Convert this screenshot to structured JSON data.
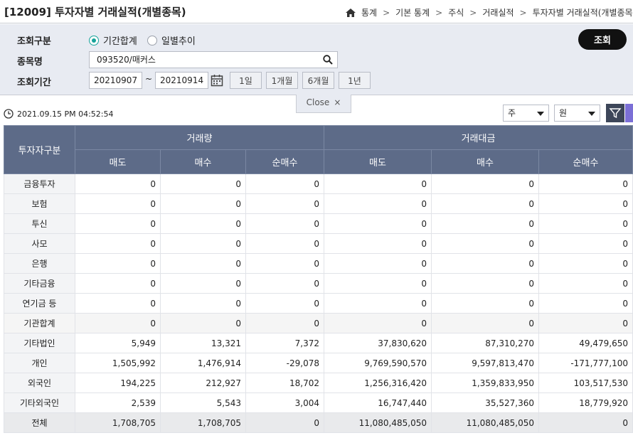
{
  "header": {
    "title": "[12009] 투자자별 거래실적(개별종목)",
    "breadcrumb": [
      "통계",
      "기본 통계",
      "주식",
      "거래실적",
      "투자자별 거래실적(개별종목"
    ]
  },
  "filter": {
    "type_label": "조회구분",
    "radio_period": "기간합계",
    "radio_daily": "일별추이",
    "selected": "기간합계",
    "stock_label": "종목명",
    "stock_value": "093520/매커스",
    "date_label": "조회기간",
    "start_date": "20210907",
    "tilde": "~",
    "end_date": "20210914",
    "period_buttons": [
      "1일",
      "1개월",
      "6개월",
      "1년"
    ],
    "inquiry_button": "조회",
    "close_label": "Close",
    "close_x": "×"
  },
  "toolbar": {
    "timestamp": "2021.09.15 PM 04:52:54",
    "unit_share": "주",
    "unit_currency": "원"
  },
  "table": {
    "investor_header": "투자자구분",
    "group1": "거래량",
    "group2": "거래대금",
    "sub_headers": [
      "매도",
      "매수",
      "순매수",
      "매도",
      "매수",
      "순매수"
    ],
    "rows": [
      {
        "name": "금융투자",
        "values": [
          "0",
          "0",
          "0",
          "0",
          "0",
          "0"
        ]
      },
      {
        "name": "보험",
        "values": [
          "0",
          "0",
          "0",
          "0",
          "0",
          "0"
        ]
      },
      {
        "name": "투신",
        "values": [
          "0",
          "0",
          "0",
          "0",
          "0",
          "0"
        ]
      },
      {
        "name": "사모",
        "values": [
          "0",
          "0",
          "0",
          "0",
          "0",
          "0"
        ]
      },
      {
        "name": "은행",
        "values": [
          "0",
          "0",
          "0",
          "0",
          "0",
          "0"
        ]
      },
      {
        "name": "기타금융",
        "values": [
          "0",
          "0",
          "0",
          "0",
          "0",
          "0"
        ]
      },
      {
        "name": "연기금 등",
        "values": [
          "0",
          "0",
          "0",
          "0",
          "0",
          "0"
        ]
      },
      {
        "name": "기관합계",
        "values": [
          "0",
          "0",
          "0",
          "0",
          "0",
          "0"
        ]
      },
      {
        "name": "기타법인",
        "values": [
          "5,949",
          "13,321",
          "7,372",
          "37,830,620",
          "87,310,270",
          "49,479,650"
        ]
      },
      {
        "name": "개인",
        "values": [
          "1,505,992",
          "1,476,914",
          "-29,078",
          "9,769,590,570",
          "9,597,813,470",
          "-171,777,100"
        ]
      },
      {
        "name": "외국인",
        "values": [
          "194,225",
          "212,927",
          "18,702",
          "1,256,316,420",
          "1,359,833,950",
          "103,517,530"
        ]
      },
      {
        "name": "기타외국인",
        "values": [
          "2,539",
          "5,543",
          "3,004",
          "16,747,440",
          "35,527,360",
          "18,779,920"
        ]
      },
      {
        "name": "전체",
        "values": [
          "1,708,705",
          "1,708,705",
          "0",
          "11,080,485,050",
          "11,080,485,050",
          "0"
        ]
      }
    ]
  },
  "colors": {
    "header_bg": "#5d6b88",
    "filter_bg": "#e8ebf2",
    "accent": "#17a39a"
  }
}
